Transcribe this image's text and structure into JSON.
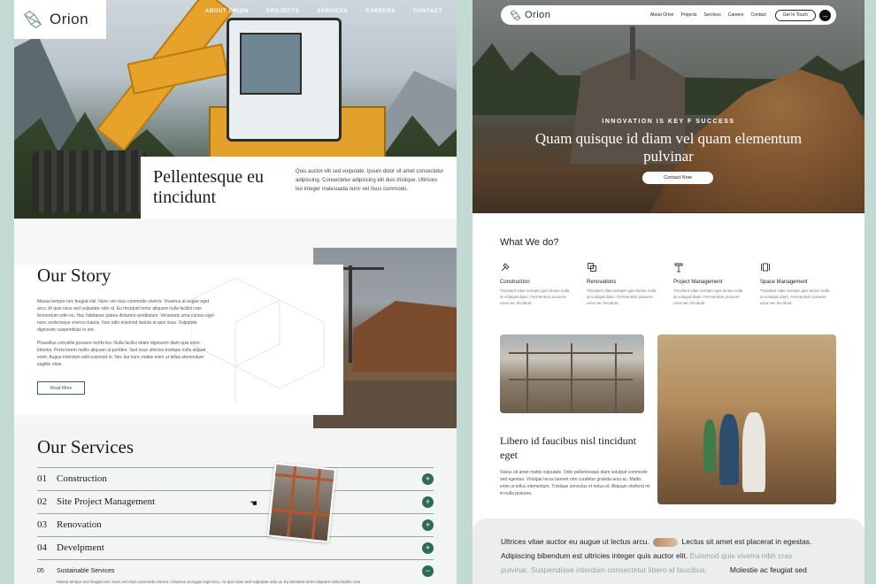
{
  "left_page": {
    "brand": "Orion",
    "nav": [
      "ABOUT ORION",
      "PROJECTS",
      "SERVICES",
      "CAREERS",
      "CONTACT"
    ],
    "hero": {
      "title": "Pellentesque eu tincidunt",
      "body": "Quis auctor elit sed vulputate. Ipsum dolor sit amet consectetur adipiscing. Consectetur adipiscing elit duis tristique. Ultricies leo integer malesuada nunc vel risus commodo."
    },
    "story": {
      "title": "Our Story",
      "p1": "Massa tempor nec feugiat nisl. Nunc vel risus commodo viverra. Vivamus at augue eget arcu. At quis risus sed vulputate odio ut. Eu tincidunt tortor aliquam nulla facilisi cras fermentum odio eu. Hac habitasse platea dictumst vestibulum. Venenatis urna cursus eget nunc scelerisque viverra mauris. Non odio euismod lacinia at quis risus. Vulputate dignissim suspendisse in est.",
      "p2": "Phasellus convallis posuere morbi leo. Nulla facilisi etiam dignissim diam quis enim lobortis. Porta lorem mollis aliquam ut porttitor. Sed risus ultricies tristique nulla aliquet enim. Augue interdum velit euismod in. Nec dui nunc mattis enim ut tellus elementum sagittis vitae.",
      "button": "Read More"
    },
    "services": {
      "title": "Our Services",
      "items": [
        {
          "num": "01",
          "name": "Construction"
        },
        {
          "num": "02",
          "name": "Site Project Management"
        },
        {
          "num": "03",
          "name": "Renovation"
        },
        {
          "num": "04",
          "name": "Develpment"
        },
        {
          "num": "05",
          "name": "Sustainable Services"
        }
      ],
      "expanded_symbol": "−",
      "collapsed_symbol": "+",
      "desc": "Massa tempor nec feugiat nisl. Nunc vel risus commodo viverra. Vivamus at augue eget arcu. At quis risus sed vulputate odio ut. Eu tincidunt tortor aliquam nulla facilisi cras"
    }
  },
  "right_page": {
    "brand": "Orion",
    "nav": [
      "About Orion",
      "Projects",
      "Services",
      "Careers",
      "Contact"
    ],
    "cta": "Get In Touch",
    "hero": {
      "eyebrow": "INNOVATION IS KEY F SUCCESS",
      "title": "Quam quisque id diam vel quam elementum pulvinar",
      "button": "Contact Now"
    },
    "what": {
      "title": "What We do?",
      "items": [
        {
          "icon": "hammer-icon",
          "title": "Construction",
          "body": "Tincidunt vitae semper quis lectus nulla at volutpat diam. Fermentum posuere urna nec tincidunt."
        },
        {
          "icon": "layers-icon",
          "title": "Renovations",
          "body": "Tincidunt vitae semper quis lectus nulla at volutpat diam. Fermentum posuere urna nec tincidunt."
        },
        {
          "icon": "crane-icon",
          "title": "Project Management",
          "body": "Tincidunt vitae semper quis lectus nulla at volutpat diam. Fermentum posuere urna nec tincidunt."
        },
        {
          "icon": "space-icon",
          "title": "Space Management",
          "body": "Tincidunt vitae semper quis lectus nulla at volutpat diam. Fermentum posuere urna nec tincidunt."
        }
      ]
    },
    "feature": {
      "title": "Libero id faucibus nisl tincidunt eget",
      "body": "Varius sit amet mattis vulputate. Odio pellentesque diam volutpat commodo sed egestas. Volutpat lacus laoreet non curabitur gravida arcu ac. Mattis enim ut tellus elementum. Tristique senectus et netus et. Aliquam eleifend mi in nulla posuere."
    },
    "quote": {
      "l1a": "Ultrices vitae auctor eu augue ut lectus arcu.",
      "l1b": "Lectus sit amet est placerat in egestas.",
      "l2a": "Adipiscing bibendum est ultricies integer quis auctor elit.",
      "l2b": "Euismod quis viverra nibh cras",
      "l3a": "pulvinar. Suspendisse interdum consectetur libero id faucibus.",
      "l3b": "Molestie ac feugiat sed"
    }
  }
}
